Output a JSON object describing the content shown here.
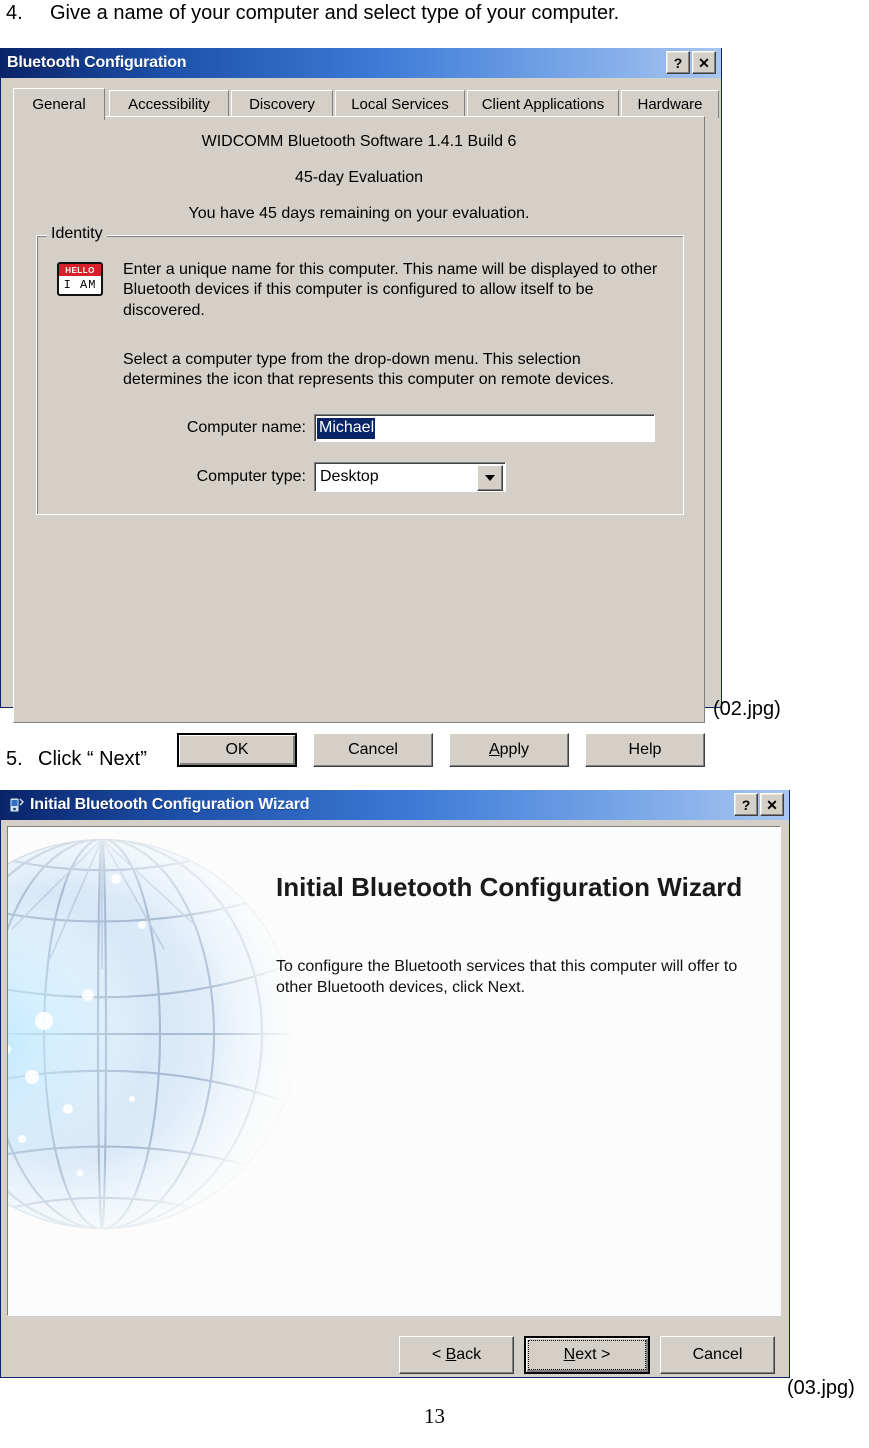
{
  "document": {
    "steps": [
      {
        "number": "4.",
        "text": "Give a name of your computer and select type of your computer."
      },
      {
        "number": "5.",
        "text": "Click “ Next”"
      }
    ],
    "captions": {
      "first": "(02.jpg)",
      "second": "(03.jpg)"
    },
    "page_number": "13"
  },
  "dialog1": {
    "title": "Bluetooth Configuration",
    "titlebar_buttons": {
      "help": "?",
      "close": "✕"
    },
    "tabs": [
      {
        "label": "General",
        "active": true
      },
      {
        "label": "Accessibility",
        "active": false
      },
      {
        "label": "Discovery",
        "active": false
      },
      {
        "label": "Local Services",
        "active": false
      },
      {
        "label": "Client Applications",
        "active": false
      },
      {
        "label": "Hardware",
        "active": false
      }
    ],
    "product_line": "WIDCOMM Bluetooth Software 1.4.1 Build 6",
    "eval_line": "45-day Evaluation",
    "remaining_line": "You have 45 days remaining on your evaluation.",
    "group": {
      "legend": "Identity",
      "icon_hello": "HELLO",
      "icon_iam": "I AM",
      "paragraph1": "Enter a unique name for this computer.  This name will be displayed to other Bluetooth devices if this computer is configured to allow itself to be discovered.",
      "paragraph2": "Select a computer type from the drop-down menu.  This selection determines the icon that represents this computer on remote devices.",
      "name_label": "Computer name:",
      "name_value": "Michael",
      "type_label": "Computer type:",
      "type_value": "Desktop"
    },
    "buttons": [
      {
        "label": "OK",
        "default": true
      },
      {
        "label": "Cancel",
        "default": false
      },
      {
        "label": "Apply",
        "default": false,
        "accel": "A"
      },
      {
        "label": "Help",
        "default": false
      }
    ]
  },
  "dialog2": {
    "title": "Initial Bluetooth Configuration Wizard",
    "titlebar_buttons": {
      "help": "?",
      "close": "✕"
    },
    "heading": "Initial Bluetooth Configuration Wizard",
    "body_text": "To configure the Bluetooth services that this computer will offer to other Bluetooth devices, click Next.",
    "buttons": [
      {
        "label": "< Back",
        "accel": "B",
        "focused": false
      },
      {
        "label": "Next >",
        "accel": "N",
        "focused": true
      },
      {
        "label": "Cancel",
        "accel": "",
        "focused": false
      }
    ]
  },
  "colors": {
    "dialog_face": "#d4d0c8",
    "title_dark": "#0a246a",
    "title_light": "#a8c6f0",
    "selection": "#0a246a",
    "tag_red": "#d8202a"
  }
}
